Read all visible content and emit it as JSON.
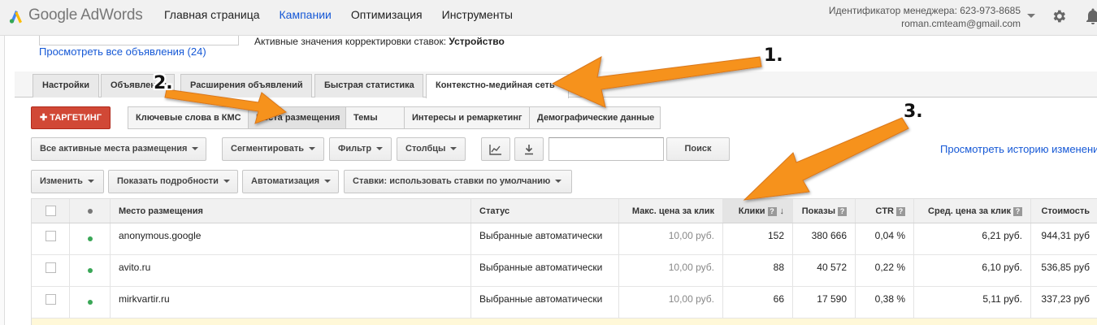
{
  "header": {
    "logo_text": "Google AdWords",
    "nav": [
      {
        "label": "Главная страница",
        "active": false
      },
      {
        "label": "Кампании",
        "active": true
      },
      {
        "label": "Оптимизация",
        "active": false
      },
      {
        "label": "Инструменты",
        "active": false
      }
    ],
    "manager_id": "Идентификатор менеджера: 623-973-8685",
    "email": "roman.cmteam@gmail.com"
  },
  "ads": {
    "view_all_label": "Просмотреть все объявления (24)",
    "bid_adjust_label": "Активные значения корректировки ставок:",
    "bid_adjust_value": "Устройство"
  },
  "tabs": [
    {
      "label": "Настройки",
      "active": false
    },
    {
      "label": "Объявления",
      "active": false
    },
    {
      "label": "Расширения объявлений",
      "active": false
    },
    {
      "label": "Быстрая статистика",
      "active": false
    },
    {
      "label": "Контекстно-медийная сеть",
      "active": true
    }
  ],
  "targeting": {
    "button_label": "ТАРГЕТИНГ",
    "subtabs": [
      {
        "label": "Ключевые слова в КМС",
        "active": false
      },
      {
        "label": "Места размещения",
        "active": true
      },
      {
        "label": "Темы",
        "active": false
      },
      {
        "label": "Интересы и ремаркетинг",
        "active": false
      },
      {
        "label": "Демографические данные",
        "active": false
      }
    ]
  },
  "toolbar": {
    "filter_all": "Все активные места размещения",
    "segment": "Сегментировать",
    "filter": "Фильтр",
    "columns": "Столбцы",
    "search_button": "Поиск",
    "search_value": "",
    "history_link": "Просмотреть историю изменени"
  },
  "toolbar2": {
    "edit": "Изменить",
    "details": "Показать подробности",
    "automation": "Автоматизация",
    "bids": "Ставки: использовать ставки по умолчанию"
  },
  "table": {
    "columns": {
      "placement": "Место размещения",
      "status": "Статус",
      "max_cpc": "Макс. цена за клик",
      "clicks": "Клики",
      "impressions": "Показы",
      "ctr": "CTR",
      "avg_cpc": "Сред. цена за клик",
      "cost": "Стоимость"
    },
    "rows": [
      {
        "placement": "anonymous.google",
        "status": "Выбранные автоматически",
        "max_cpc": "10,00 руб.",
        "clicks": "152",
        "impressions": "380 666",
        "ctr": "0,04 %",
        "avg_cpc": "6,21 руб.",
        "cost": "944,31 руб"
      },
      {
        "placement": "avito.ru",
        "status": "Выбранные автоматически",
        "max_cpc": "10,00 руб.",
        "clicks": "88",
        "impressions": "40 572",
        "ctr": "0,22 %",
        "avg_cpc": "6,10 руб.",
        "cost": "536,85 руб"
      },
      {
        "placement": "mirkvartir.ru",
        "status": "Выбранные автоматически",
        "max_cpc": "10,00 руб.",
        "clicks": "66",
        "impressions": "17 590",
        "ctr": "0,38 %",
        "avg_cpc": "5,11 руб.",
        "cost": "337,23 руб"
      }
    ]
  },
  "annotations": {
    "label_1": "1.",
    "label_2": "2.",
    "label_3": "3.",
    "arrow_color": "#f6921e"
  },
  "colors": {
    "link": "#1558d6",
    "targeting_button": "#d14836",
    "status_dot_active": "#3aa757",
    "status_dot_header": "#777777"
  }
}
